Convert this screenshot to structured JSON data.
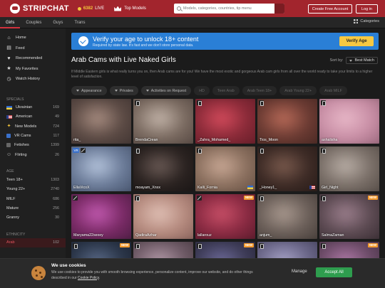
{
  "header": {
    "logo_text": "STRIPCHAT",
    "live_count": "6382",
    "live_label": "LIVE",
    "top_models_label": "Top Models",
    "search_placeholder": "Models, categories, countries, tip menu",
    "create_account_label": "Create Free Account",
    "login_label": "Log in",
    "accent_color": "#a2252d"
  },
  "category_tabs": [
    {
      "label": "Girls",
      "active": true
    },
    {
      "label": "Couples"
    },
    {
      "label": "Guys"
    },
    {
      "label": "Trans"
    }
  ],
  "categories_button": "Categories",
  "sidebar": {
    "nav": [
      {
        "label": "Home",
        "icon": "home-icon"
      },
      {
        "label": "Feed",
        "icon": "feed-icon"
      },
      {
        "label": "Recommended",
        "icon": "heart-icon"
      },
      {
        "label": "My Favorites",
        "icon": "star-icon"
      },
      {
        "label": "Watch History",
        "icon": "history-icon"
      }
    ],
    "specials_title": "SPECIALS",
    "specials": [
      {
        "label": "Ukrainian",
        "count": "169",
        "icon": "ukraine-flag-icon"
      },
      {
        "label": "American",
        "count": "49",
        "icon": "usa-flag-icon"
      },
      {
        "label": "New Models",
        "count": "724",
        "icon": "new-icon"
      },
      {
        "label": "VR Cams",
        "count": "117",
        "icon": "vr-icon"
      },
      {
        "label": "Fetishes",
        "count": "1399",
        "icon": "fetish-icon"
      },
      {
        "label": "Flirting",
        "count": "26",
        "icon": "flirt-icon"
      }
    ],
    "age_title": "AGE",
    "age": [
      {
        "label": "Teen 18+",
        "count": "1303"
      },
      {
        "label": "Young 22+",
        "count": "2740"
      },
      {
        "label": "MILF",
        "count": "686"
      },
      {
        "label": "Mature",
        "count": "256"
      },
      {
        "label": "Granny",
        "count": "30"
      }
    ],
    "ethnicity_title": "ETHNICITY",
    "ethnicity": [
      {
        "label": "Arab",
        "count": "102",
        "active": true
      }
    ]
  },
  "verify_banner": {
    "title": "Verify your age to unlock 18+ content",
    "subtitle": "Required by state law. It's fast and we don't store personal data.",
    "button": "Verify Age",
    "color": "#2a7fd6"
  },
  "main": {
    "title": "Arab Cams with Live Naked Girls",
    "sort_label": "Sort by:",
    "sort_value": "Best Match",
    "description": "If Middle Eastern girls is what really turns you on, then Arab cams are for you! We have the most exotic and gorgeous Arab cam girls from all over the world ready to take your limits to a higher level of satisfaction.",
    "filters": [
      {
        "label": "Appearance",
        "dropdown": true
      },
      {
        "label": "Privates",
        "dropdown": true
      },
      {
        "label": "Activities on Request",
        "dropdown": true
      },
      {
        "label": "HD",
        "dim": true
      },
      {
        "label": "Teen Arab",
        "dim": true
      },
      {
        "label": "Arab Teen 18+",
        "dim": true
      },
      {
        "label": "Arab Young 22+",
        "dim": true
      },
      {
        "label": "Arab MILF",
        "dim": true
      }
    ]
  },
  "models": [
    {
      "name": "rita_",
      "colors": [
        "#5b4a44",
        "#a78c80",
        "#3a2f2e"
      ]
    },
    {
      "name": "BrendaCrean",
      "colors": [
        "#7a6a60",
        "#c2b3a8",
        "#4a3d39"
      ],
      "badges": [
        "phone"
      ]
    },
    {
      "name": "_Zahra_Mohamed_",
      "colors": [
        "#8a2a38",
        "#d44b5c",
        "#5a1a24"
      ],
      "badges": [
        "phone"
      ]
    },
    {
      "name": "Tios_Moon",
      "colors": [
        "#6a3a32",
        "#b86a58",
        "#402420"
      ],
      "badges": [
        "phone"
      ]
    },
    {
      "name": "ashalisha",
      "colors": [
        "#c98fa6",
        "#e8b8c8",
        "#8a5a6e"
      ],
      "badges": [
        "phone"
      ]
    },
    {
      "name": "EllaVicoX",
      "colors": [
        "#6b7b98",
        "#b5c4dc",
        "#3c4860"
      ],
      "badges": [
        "vr",
        "noeye"
      ]
    },
    {
      "name": "moayam_Xnxx",
      "colors": [
        "#2a2220",
        "#6a5a55",
        "#151212"
      ],
      "badges": [
        "phone"
      ]
    },
    {
      "name": "Kalli_Fornia",
      "colors": [
        "#8a6f5e",
        "#c9a895",
        "#5a4539"
      ],
      "badges": [
        "phone"
      ],
      "flag": "ua"
    },
    {
      "name": "_Honey1_",
      "colors": [
        "#3c2a25",
        "#7a5a4d",
        "#231815"
      ],
      "badges": [
        "phone"
      ],
      "flag": "us"
    },
    {
      "name": "Girl_Night",
      "colors": [
        "#7a6f68",
        "#b9aea6",
        "#4a423d"
      ],
      "badges": [
        "phone"
      ]
    },
    {
      "name": "Maryama22sexey",
      "colors": [
        "#7a2a66",
        "#c25ab0",
        "#3e1a38"
      ],
      "badges": [
        "noeye"
      ]
    },
    {
      "name": "QadiraAzhar",
      "colors": [
        "#b58a7e",
        "#e0c0b5",
        "#7a5550"
      ],
      "badges": [
        "phone"
      ]
    },
    {
      "name": "lallarouz",
      "colors": [
        "#8a2a42",
        "#c95068",
        "#4a1624"
      ],
      "badges": [
        "noeye"
      ],
      "new": true
    },
    {
      "name": "anjum_",
      "colors": [
        "#6a5e58",
        "#a9998f",
        "#3c3431"
      ],
      "badges": [
        "phone"
      ]
    },
    {
      "name": "SalmaZaman",
      "colors": [
        "#5c4a52",
        "#9c7f8d",
        "#30262b"
      ],
      "badges": [
        "phone"
      ],
      "new": true
    },
    {
      "name": "",
      "colors": [
        "#2a3548",
        "#5a6a88",
        "#161c28"
      ],
      "badges": [
        "phone"
      ],
      "new": true
    },
    {
      "name": "",
      "colors": [
        "#6e5a66",
        "#b39aa8",
        "#3e3238"
      ],
      "badges": [
        "phone"
      ]
    },
    {
      "name": "",
      "colors": [
        "#3c3a55",
        "#6e6b9a",
        "#201f30"
      ],
      "badges": [
        "phone"
      ],
      "new": true
    },
    {
      "name": "",
      "colors": [
        "#6a6688",
        "#a8a4c8",
        "#3a3850"
      ],
      "badges": [
        "phone"
      ]
    },
    {
      "name": "",
      "colors": [
        "#6a4a66",
        "#b07aa8",
        "#3c2a3a"
      ],
      "badges": [
        "phone"
      ],
      "new": true
    }
  ],
  "cookie_banner": {
    "title": "We use cookies",
    "text": "We use cookies to provide you with smooth browsing experience, personalize content, improve our website, and do other things described in our",
    "policy_link": "Cookie Policy",
    "manage_label": "Manage",
    "accept_label": "Accept All"
  }
}
